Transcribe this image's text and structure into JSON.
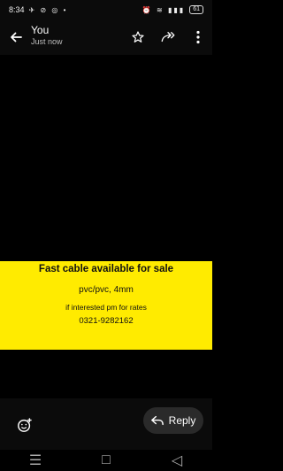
{
  "status_bar": {
    "time": "8:34",
    "left_icons": "✈ ⊘ ◎ •",
    "right_icons": "⏰ ≋ ▮▮▮",
    "battery": "61"
  },
  "header": {
    "title": "You",
    "subtitle": "Just now"
  },
  "media": {
    "line1": "Fast cable available for sale",
    "line2": "pvc/pvc, 4mm",
    "line3": "if interested pm for rates",
    "line4": "0321-9282162"
  },
  "actions": {
    "reply_label": "Reply"
  },
  "nav": {
    "recent_symbol": "☰",
    "home_symbol": "□",
    "back_symbol": "◁"
  },
  "colors": {
    "banner": "#ffeb00",
    "background": "#000000"
  }
}
